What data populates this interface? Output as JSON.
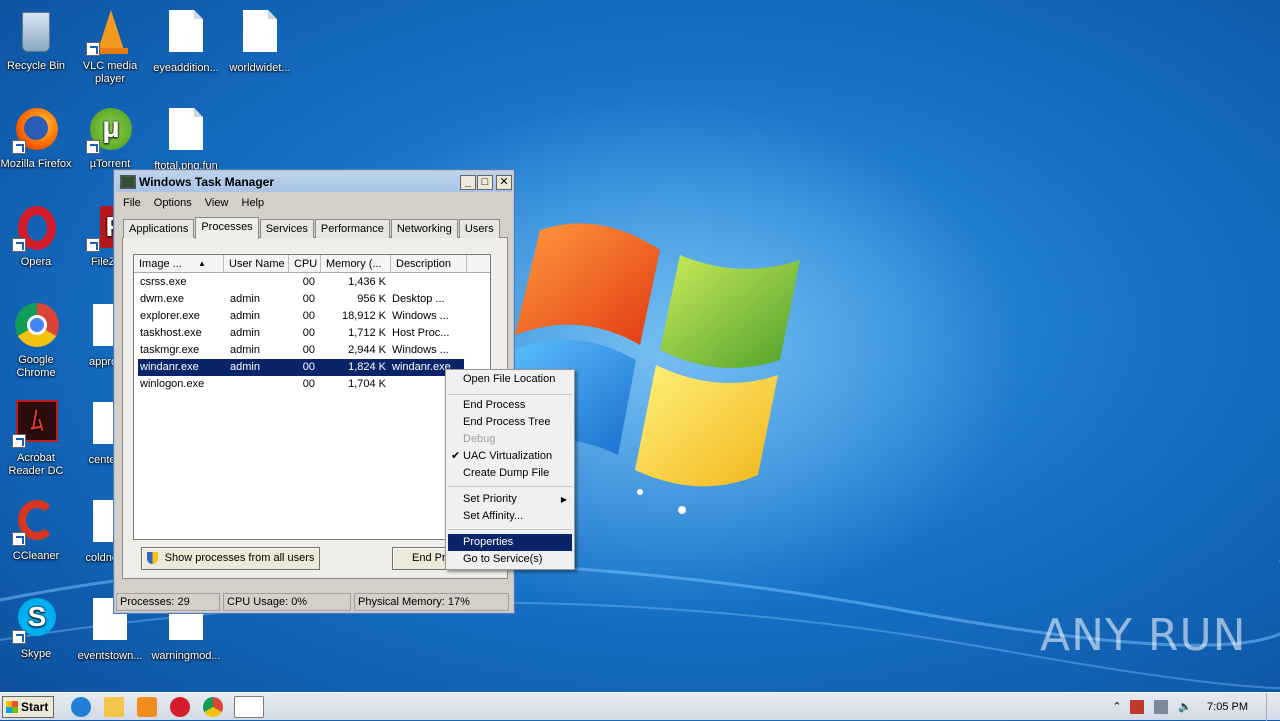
{
  "desktop_icons": [
    {
      "label": "Recycle Bin"
    },
    {
      "label": "VLC media player"
    },
    {
      "label": "eyeaddition..."
    },
    {
      "label": "worldwidet..."
    },
    {
      "label": "Mozilla Firefox"
    },
    {
      "label": "µTorrent"
    },
    {
      "label": "ftotal.png.fun"
    },
    {
      "label": "Opera"
    },
    {
      "label": "FileZilla"
    },
    {
      "label": "Google Chrome"
    },
    {
      "label": "approv..."
    },
    {
      "label": "Acrobat Reader DC"
    },
    {
      "label": "centert..."
    },
    {
      "label": "CCleaner"
    },
    {
      "label": "coldnew..."
    },
    {
      "label": "Skype"
    },
    {
      "label": "eventstown..."
    },
    {
      "label": "warningmod..."
    }
  ],
  "window": {
    "title": "Windows Task Manager",
    "minimize": "_",
    "maximize": "□",
    "close": "✕",
    "menu": [
      "File",
      "Options",
      "View",
      "Help"
    ],
    "tabs": [
      "Applications",
      "Processes",
      "Services",
      "Performance",
      "Networking",
      "Users"
    ],
    "active_tab": "Processes"
  },
  "process_table": {
    "columns": [
      "Image ...",
      "User Name",
      "CPU",
      "Memory (...",
      "Description"
    ],
    "rows": [
      {
        "image": "csrss.exe",
        "user": "",
        "cpu": "00",
        "mem": "1,436 K",
        "desc": ""
      },
      {
        "image": "dwm.exe",
        "user": "admin",
        "cpu": "00",
        "mem": "956 K",
        "desc": "Desktop ..."
      },
      {
        "image": "explorer.exe",
        "user": "admin",
        "cpu": "00",
        "mem": "18,912 K",
        "desc": "Windows ..."
      },
      {
        "image": "taskhost.exe",
        "user": "admin",
        "cpu": "00",
        "mem": "1,712 K",
        "desc": "Host Proc..."
      },
      {
        "image": "taskmgr.exe",
        "user": "admin",
        "cpu": "00",
        "mem": "2,944 K",
        "desc": "Windows ..."
      },
      {
        "image": "windanr.exe",
        "user": "admin",
        "cpu": "00",
        "mem": "1,824 K",
        "desc": "windanr.exe"
      },
      {
        "image": "winlogon.exe",
        "user": "",
        "cpu": "00",
        "mem": "1,704 K",
        "desc": ""
      }
    ],
    "selected_row": 5
  },
  "buttons": {
    "show_all": "Show processes from all users",
    "end_process": "End Pr"
  },
  "status": {
    "processes": "Processes: 29",
    "cpu": "CPU Usage: 0%",
    "memory": "Physical Memory: 17%"
  },
  "context_menu": {
    "items": [
      {
        "label": "Open File Location"
      },
      {
        "label": "End Process"
      },
      {
        "label": "End Process Tree"
      },
      {
        "label": "Debug"
      },
      {
        "label": "UAC Virtualization"
      },
      {
        "label": "Create Dump File"
      },
      {
        "label": "Set Priority"
      },
      {
        "label": "Set Affinity..."
      },
      {
        "label": "Properties"
      },
      {
        "label": "Go to Service(s)"
      }
    ]
  },
  "taskbar": {
    "start_label": "Start",
    "clock": "7:05 PM"
  },
  "watermark": "ANY RUN"
}
